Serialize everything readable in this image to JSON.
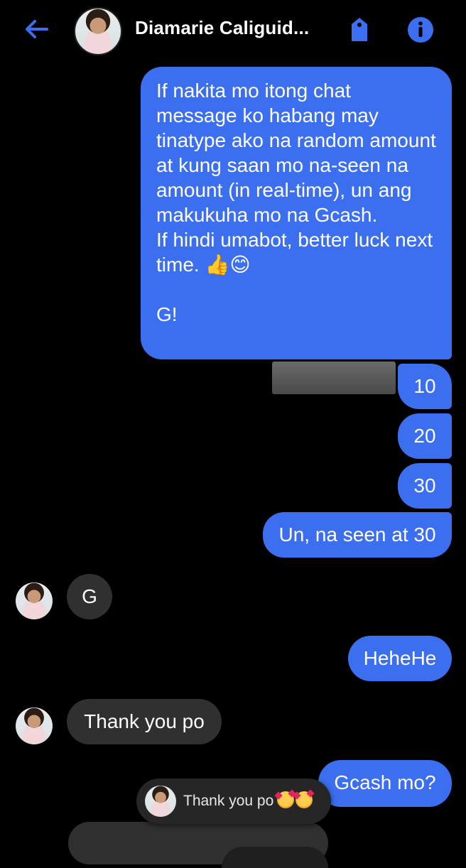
{
  "header": {
    "title": "Diamarie Caliguid...",
    "back_icon": "arrow-left-icon",
    "tag_icon": "tag-icon",
    "info_icon": "info-icon"
  },
  "colors": {
    "background": "#000000",
    "outgoing_bubble": "#3b6ff0",
    "incoming_bubble": "#303030",
    "accent": "#3b6ff0"
  },
  "messages": [
    {
      "sender": "me",
      "text": "If nakita mo itong chat message ko habang may tinatype ako na random amount at kung saan mo na-seen na amount (in real-time),  un ang makukuha mo na Gcash.\nIf hindi umabot, better luck next time. 👍😊\n\nG!"
    },
    {
      "sender": "me",
      "text": "10"
    },
    {
      "sender": "me",
      "text": "20"
    },
    {
      "sender": "me",
      "text": "30"
    },
    {
      "sender": "me",
      "text": "Un, na seen at 30"
    },
    {
      "sender": "them",
      "text": "G"
    },
    {
      "sender": "me",
      "text": "HeheHe"
    },
    {
      "sender": "them",
      "text": "Thank you po"
    },
    {
      "sender": "me",
      "text": "Gcash mo?"
    }
  ],
  "notification": {
    "text": "Thank you po",
    "emojis": [
      "smiling-face-with-hearts",
      "smiling-face-with-hearts"
    ]
  }
}
